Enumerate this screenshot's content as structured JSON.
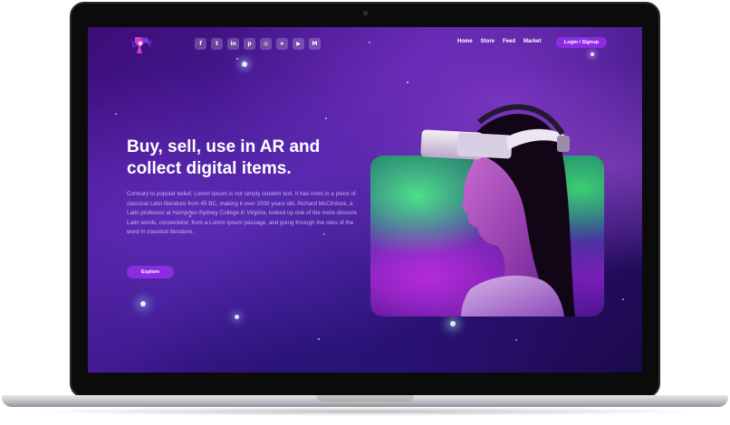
{
  "nav": {
    "socials": [
      {
        "icon": "facebook-icon",
        "glyph": "f"
      },
      {
        "icon": "twitter-icon",
        "glyph": "t"
      },
      {
        "icon": "linkedin-icon",
        "glyph": "in"
      },
      {
        "icon": "pinterest-icon",
        "glyph": "p"
      },
      {
        "icon": "instagram-icon",
        "glyph": "◎"
      },
      {
        "icon": "telegram-icon",
        "glyph": "➤"
      },
      {
        "icon": "youtube-icon",
        "glyph": "▶"
      },
      {
        "icon": "medium-icon",
        "glyph": "M"
      }
    ],
    "links": [
      "Home",
      "Store",
      "Feed",
      "Market"
    ],
    "login_label": "Login / Signup"
  },
  "hero": {
    "title_line1": "Buy, sell, use in AR and",
    "title_line2": "collect digital items.",
    "body": "Contrary to popular belief, Lorem Ipsum is not simply random text. It has roots in a piece of classical Latin literature from 45 BC, making it over 2000 years old. Richard McClintock, a Latin professor at Hampden-Sydney College in Virginia, looked up one of the more obscure Latin words, consectetur, from a Lorem Ipsum passage, and going through the cites of the word in classical literature.",
    "explore_label": "Explore"
  },
  "colors": {
    "accent": "#8b2be2",
    "background": "#3b0e78"
  }
}
